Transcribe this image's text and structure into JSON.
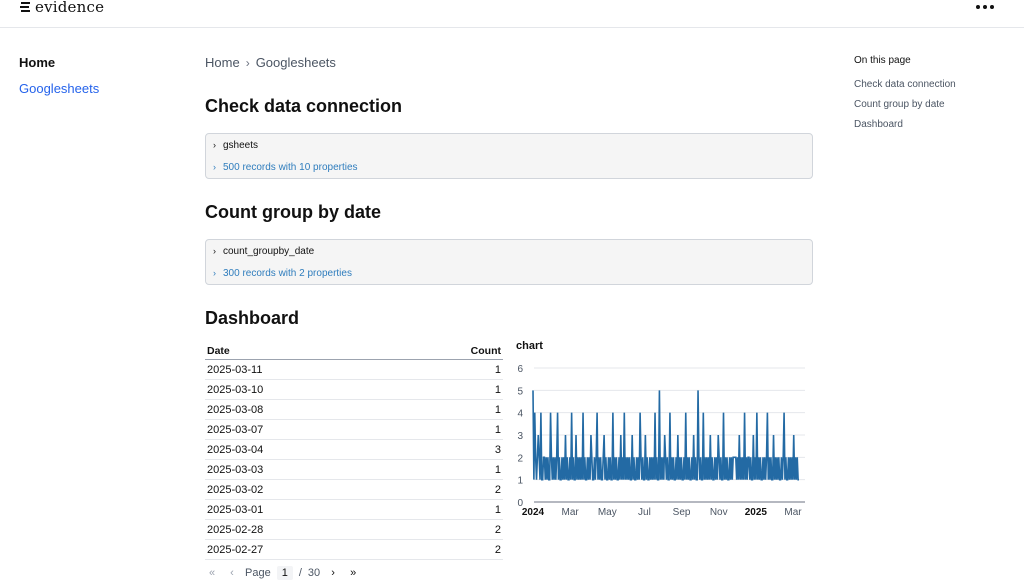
{
  "app": {
    "logo_text": "evidence"
  },
  "sidebar": {
    "items": [
      {
        "label": "Home"
      },
      {
        "label": "Googlesheets"
      }
    ]
  },
  "breadcrumb": {
    "items": [
      "Home",
      "Googlesheets"
    ]
  },
  "sections": [
    {
      "title": "Check data connection",
      "query": {
        "name": "gsheets",
        "meta": "500 records with 10 properties"
      }
    },
    {
      "title": "Count group by date",
      "query": {
        "name": "count_groupby_date",
        "meta": "300 records with 2 properties"
      }
    },
    {
      "title": "Dashboard"
    }
  ],
  "toc": {
    "title": "On this page",
    "items": [
      "Check data connection",
      "Count group by date",
      "Dashboard"
    ]
  },
  "table": {
    "columns": [
      "Date",
      "Count"
    ],
    "rows": [
      [
        "2025-03-11",
        "1"
      ],
      [
        "2025-03-10",
        "1"
      ],
      [
        "2025-03-08",
        "1"
      ],
      [
        "2025-03-07",
        "1"
      ],
      [
        "2025-03-04",
        "3"
      ],
      [
        "2025-03-03",
        "1"
      ],
      [
        "2025-03-02",
        "2"
      ],
      [
        "2025-03-01",
        "1"
      ],
      [
        "2025-02-28",
        "2"
      ],
      [
        "2025-02-27",
        "2"
      ]
    ]
  },
  "pager": {
    "label": "Page",
    "current": "1",
    "separator": "/",
    "total": "30"
  },
  "chart_data": {
    "type": "line",
    "title": "chart",
    "xlabel": "",
    "ylabel": "",
    "color": "#236aa4",
    "ylim": [
      0,
      6
    ],
    "yticks": [
      "0",
      "1",
      "2",
      "3",
      "4",
      "5",
      "6"
    ],
    "xticks": [
      {
        "label": "2024",
        "bold": true
      },
      {
        "label": "Mar",
        "bold": false
      },
      {
        "label": "May",
        "bold": false
      },
      {
        "label": "Jul",
        "bold": false
      },
      {
        "label": "Sep",
        "bold": false
      },
      {
        "label": "Nov",
        "bold": false
      },
      {
        "label": "2025",
        "bold": true
      },
      {
        "label": "Mar",
        "bold": false
      }
    ],
    "x_start": "2024-01-01",
    "x_end": "2025-03-11",
    "series": [
      {
        "values": [
          5,
          1,
          4,
          2,
          1,
          2,
          3,
          2,
          1,
          4,
          1,
          1,
          2,
          2,
          1,
          2,
          1,
          2,
          1,
          1,
          4,
          2,
          1,
          2,
          1,
          2,
          1,
          2,
          4,
          1,
          2,
          1,
          1,
          2,
          1,
          2,
          1,
          3,
          1,
          2,
          1,
          1,
          2,
          1,
          4,
          1,
          2,
          1,
          1,
          3,
          1,
          2,
          1,
          2,
          1,
          2,
          1,
          4,
          1,
          2,
          1,
          1,
          2,
          1,
          2,
          1,
          3,
          2,
          1,
          1,
          2,
          1,
          2,
          4,
          1,
          2,
          1,
          2,
          1,
          1,
          2,
          3,
          1,
          2,
          1,
          1,
          2,
          1,
          2,
          1,
          1,
          4,
          1,
          2,
          1,
          2,
          1,
          1,
          2,
          1,
          3,
          1,
          2,
          1,
          4,
          1,
          2,
          1,
          2,
          1,
          2,
          1,
          1,
          3,
          1,
          2,
          1,
          1,
          2,
          1,
          2,
          1,
          4,
          2,
          1,
          2,
          1,
          1,
          3,
          1,
          2,
          1,
          1,
          2,
          1,
          2,
          1,
          2,
          1,
          4,
          1,
          2,
          1,
          1,
          5,
          1,
          2,
          1,
          2,
          1,
          3,
          2,
          1,
          2,
          1,
          1,
          4,
          1,
          2,
          1,
          2,
          1,
          1,
          2,
          1,
          3,
          1,
          2,
          1,
          2,
          1,
          1,
          2,
          1,
          4,
          1,
          2,
          1,
          2,
          1,
          1,
          2,
          1,
          3,
          1,
          2,
          1,
          1,
          5,
          2,
          1,
          2,
          1,
          1,
          4,
          1,
          2,
          1,
          2,
          1,
          2,
          1,
          3,
          1,
          2,
          1,
          1,
          2,
          1,
          2,
          1,
          3,
          2,
          1,
          2,
          1,
          1,
          4,
          1,
          2,
          1,
          2,
          1,
          1,
          2,
          1,
          2,
          1,
          2,
          2,
          2,
          2,
          1,
          2,
          1,
          3,
          1,
          2,
          1,
          2,
          1,
          4,
          1,
          2,
          1,
          2,
          2,
          1,
          2,
          1,
          1,
          3,
          1,
          2,
          1,
          4,
          1,
          2,
          1,
          2,
          1,
          1,
          2,
          1,
          2,
          1,
          2,
          4,
          1,
          2,
          1,
          2,
          1,
          1,
          3,
          1,
          2,
          1,
          2,
          1,
          2,
          1,
          1,
          2,
          1,
          2,
          4,
          1,
          2,
          1,
          1,
          2,
          1,
          2,
          1,
          2,
          1,
          3,
          1,
          2,
          1,
          2,
          1,
          1
        ]
      }
    ]
  }
}
